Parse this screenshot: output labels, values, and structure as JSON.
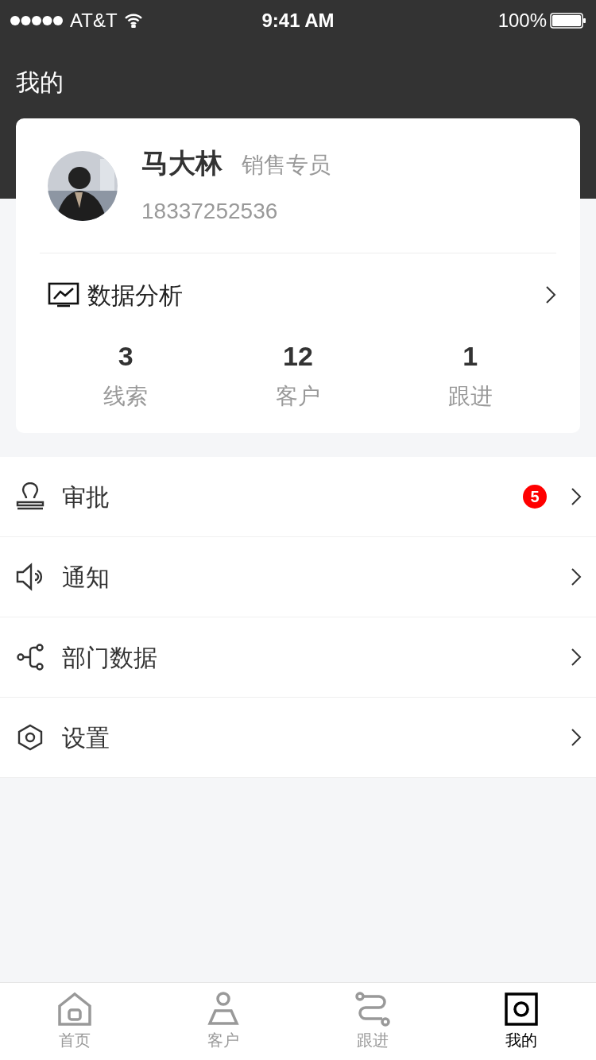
{
  "status_bar": {
    "carrier": "AT&T",
    "time": "9:41 AM",
    "battery": "100%"
  },
  "header": {
    "title": "我的"
  },
  "profile": {
    "name": "马大林",
    "role": "销售专员",
    "phone": "18337252536"
  },
  "analysis": {
    "label": "数据分析"
  },
  "stats": [
    {
      "value": "3",
      "label": "线索"
    },
    {
      "value": "12",
      "label": "客户"
    },
    {
      "value": "1",
      "label": "跟进"
    }
  ],
  "menu": [
    {
      "kind": "stamp",
      "label": "审批",
      "badge": "5"
    },
    {
      "kind": "speaker",
      "label": "通知"
    },
    {
      "kind": "share",
      "label": "部门数据"
    },
    {
      "kind": "settings",
      "label": "设置"
    }
  ],
  "tabs": [
    {
      "kind": "home",
      "label": "首页",
      "selected": false
    },
    {
      "kind": "person",
      "label": "客户",
      "selected": false
    },
    {
      "kind": "route",
      "label": "跟进",
      "selected": false
    },
    {
      "kind": "profile",
      "label": "我的",
      "selected": true
    }
  ]
}
